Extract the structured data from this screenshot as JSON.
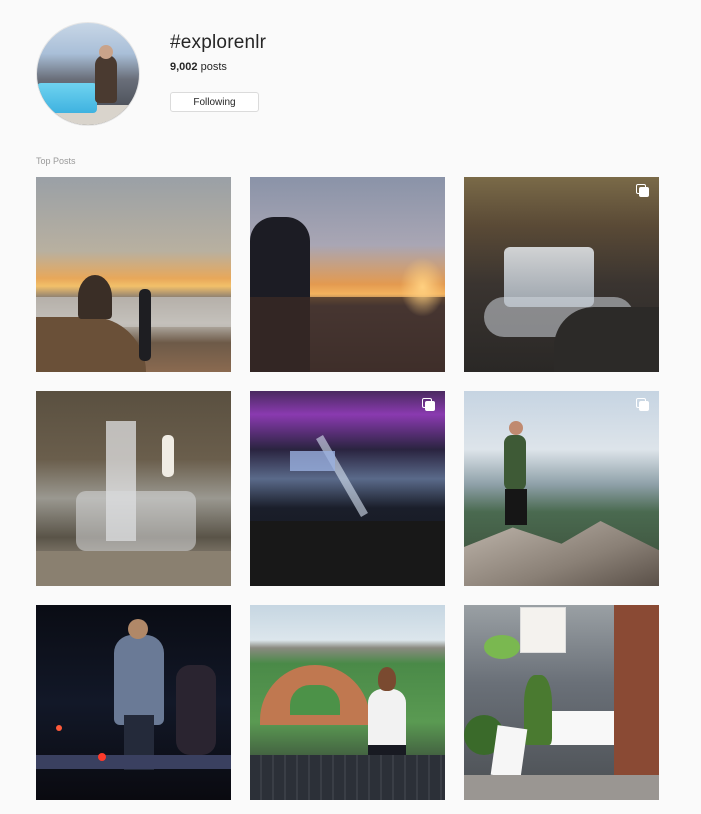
{
  "header": {
    "tag": "#explorenlr",
    "posts_count": "9,002",
    "posts_suffix": " posts",
    "follow_label": "Following"
  },
  "section": {
    "label": "Top Posts"
  },
  "posts": [
    {
      "name": "sunset-river-overlook",
      "multi": false
    },
    {
      "name": "hooded-man-sunset",
      "multi": false
    },
    {
      "name": "waterfall-rocks",
      "multi": true
    },
    {
      "name": "woman-at-waterfall",
      "multi": false
    },
    {
      "name": "concert-arena",
      "multi": true
    },
    {
      "name": "man-on-mountain-rock",
      "multi": true
    },
    {
      "name": "singer-on-stage",
      "multi": false
    },
    {
      "name": "woman-at-ballpark",
      "multi": false
    },
    {
      "name": "garden-bistro-storefront",
      "multi": false
    }
  ],
  "icons": {
    "multi_post": "carousel-icon"
  },
  "colors": {
    "background": "#fafafa",
    "border": "#dbdbdb",
    "muted_text": "#999999"
  }
}
